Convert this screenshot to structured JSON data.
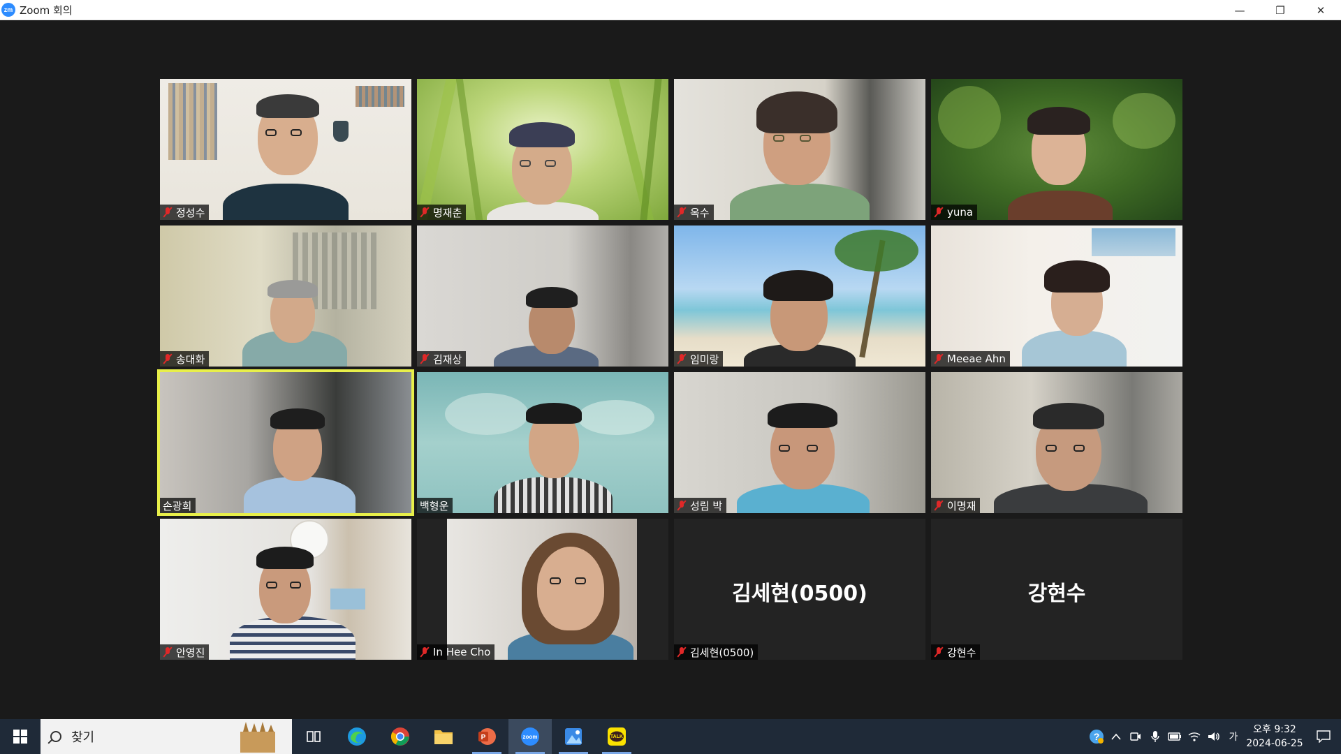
{
  "window": {
    "app_icon": "zm",
    "title": "Zoom 회의",
    "minimize": "—",
    "restore": "❐",
    "close": "✕"
  },
  "participants": [
    {
      "name": "정성수",
      "muted": true
    },
    {
      "name": "명재춘",
      "muted": true
    },
    {
      "name": "옥수",
      "muted": true
    },
    {
      "name": "yuna",
      "muted": true
    },
    {
      "name": "송대화",
      "muted": true
    },
    {
      "name": "김재상",
      "muted": true
    },
    {
      "name": "임미랑",
      "muted": true
    },
    {
      "name": "Meeae Ahn",
      "muted": true
    },
    {
      "name": "손광희",
      "muted": false,
      "active_speaker": true
    },
    {
      "name": "백형운",
      "muted": false
    },
    {
      "name": "성림 박",
      "muted": true
    },
    {
      "name": "이명재",
      "muted": true
    },
    {
      "name": "안영진",
      "muted": true
    },
    {
      "name": "In Hee Cho",
      "muted": true
    },
    {
      "name": "김세현(0500)",
      "muted": true,
      "video_off": true,
      "display_name": "김세현(0500)"
    },
    {
      "name": "강현수",
      "muted": true,
      "video_off": true,
      "display_name": "강현수"
    }
  ],
  "colors": {
    "active_speaker_border": "#e8ef4a",
    "muted_icon": "#e02828",
    "taskbar": "#1f2a38"
  },
  "taskbar": {
    "search_placeholder": "찾기",
    "apps": [
      "task-view",
      "edge",
      "chrome",
      "file-explorer",
      "powerpoint",
      "zoom",
      "photos",
      "kakaotalk"
    ],
    "zoom_label": "zoom",
    "kakao_label": "TALK",
    "ime_indicator": "가",
    "clock_time": "오후 9:32",
    "clock_date": "2024-06-25"
  }
}
